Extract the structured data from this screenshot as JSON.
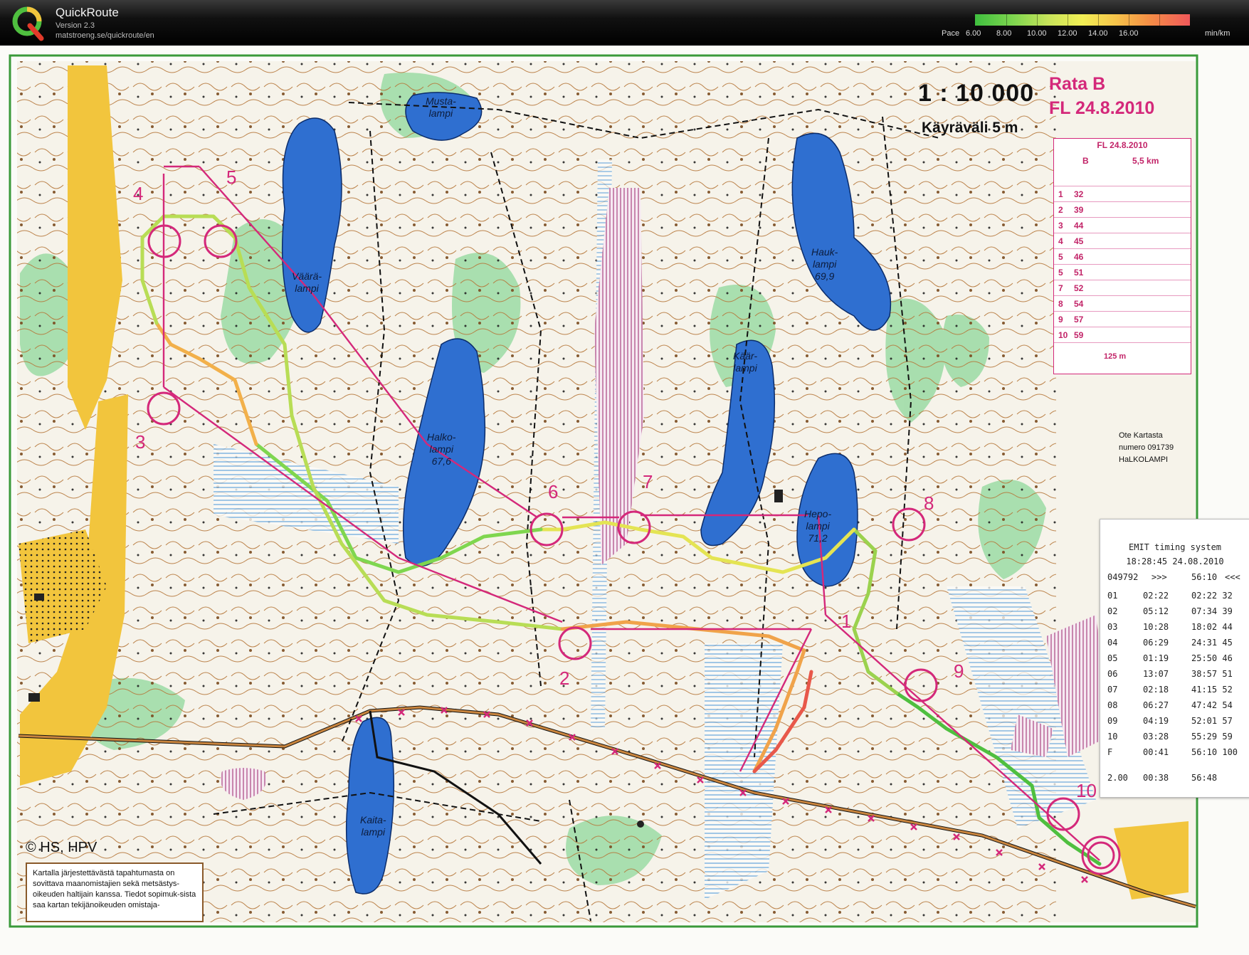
{
  "app": {
    "title": "QuickRoute",
    "version": "Version 2.3",
    "url": "matstroeng.se/quickroute/en"
  },
  "pace_legend": {
    "label": "Pace",
    "ticks": [
      "6.00",
      "8.00",
      "10.00",
      "12.00",
      "14.00",
      "16.00"
    ],
    "unit": "min/km"
  },
  "map": {
    "scale": "1 : 10 000",
    "contour": "Käyräväli 5 m",
    "course": "Rata B",
    "date": "FL 24.8.2010",
    "copyright": "©   HS, HPV",
    "source": [
      "Ote Kartasta",
      "numero 091739",
      "HaLKOLAMPI"
    ],
    "notice": "Kartalla järjestettävästä tapahtumasta on sovittava maanomistajien sekä metsästys-oikeuden haltijain kanssa. Tiedot sopimuk-sista saa kartan tekijänoikeuden omistaja-",
    "lakes": [
      {
        "name": "Musta-\nlampi"
      },
      {
        "name": "Väärä-\nlampi"
      },
      {
        "name": "Halko-\nlampi\n67,6"
      },
      {
        "name": "Hauk-\nlampi\n69,9"
      },
      {
        "name": "Käär-\nlampi"
      },
      {
        "name": "Hepo-\nlampi\n71,2"
      },
      {
        "name": "Kaita-\nlampi"
      }
    ],
    "controls": [
      "1",
      "2",
      "3",
      "4",
      "5",
      "6",
      "7",
      "8",
      "9",
      "10"
    ]
  },
  "description_card": {
    "header": "FL 24.8.2010",
    "class": "B",
    "length": "5,5 km",
    "rows": [
      {
        "n": "1",
        "code": "32"
      },
      {
        "n": "2",
        "code": "39"
      },
      {
        "n": "3",
        "code": "44"
      },
      {
        "n": "4",
        "code": "45"
      },
      {
        "n": "5",
        "code": "46"
      },
      {
        "n": "5",
        "code": "51"
      },
      {
        "n": "7",
        "code": "52"
      },
      {
        "n": "8",
        "code": "54"
      },
      {
        "n": "9",
        "code": "57"
      },
      {
        "n": "10",
        "code": "59"
      }
    ],
    "leg": "125 m"
  },
  "emit": {
    "title": "EMIT timing system",
    "timestamp": "18:28:45  24.08.2010",
    "card": "049792",
    "arrows": ">>>",
    "total": "56:10",
    "end": "<<<",
    "splits": [
      {
        "c": "01",
        "leg": "02:22",
        "cum": "02:22 32"
      },
      {
        "c": "02",
        "leg": "05:12",
        "cum": "07:34 39"
      },
      {
        "c": "03",
        "leg": "10:28",
        "cum": "18:02 44"
      },
      {
        "c": "04",
        "leg": "06:29",
        "cum": "24:31 45"
      },
      {
        "c": "05",
        "leg": "01:19",
        "cum": "25:50 46"
      },
      {
        "c": "06",
        "leg": "13:07",
        "cum": "38:57 51"
      },
      {
        "c": "07",
        "leg": "02:18",
        "cum": "41:15 52"
      },
      {
        "c": "08",
        "leg": "06:27",
        "cum": "47:42 54"
      },
      {
        "c": "09",
        "leg": "04:19",
        "cum": "52:01 57"
      },
      {
        "c": "10",
        "leg": "03:28",
        "cum": "55:29 59"
      },
      {
        "c": "F",
        "leg": "00:41",
        "cum": "56:10 100"
      }
    ],
    "footer": {
      "a": "2.00",
      "b": "00:38",
      "c": "56:48"
    }
  },
  "colors": {
    "course": "#d4287a",
    "water": "#2f6fd0",
    "open": "#f2c53d",
    "forest": "#ffffff",
    "green": "#7ccf8a",
    "route_fast": "#3fbf3f",
    "route_slow": "#f0585a"
  }
}
